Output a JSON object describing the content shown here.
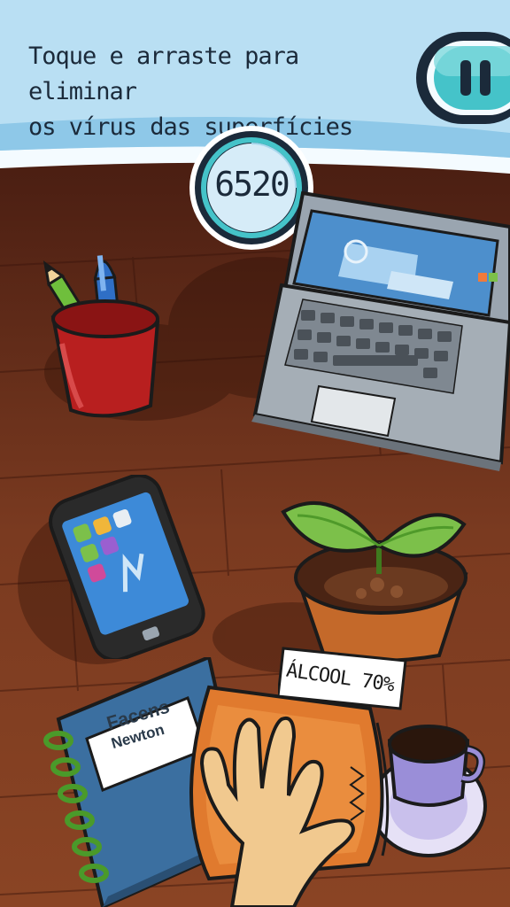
{
  "hud": {
    "instruction_line1": "Toque e arraste para eliminar",
    "instruction_line2": "os vírus das superfícies",
    "score": "6520",
    "pause_icon": "pause-icon"
  },
  "items": {
    "sanitizer_label": "ÁLCOOL 70%",
    "notebook_brand1": "Facens",
    "notebook_brand2": "Newton"
  },
  "colors": {
    "banner": "#b9dff3",
    "desk": "#6a2f1c",
    "ui_dark": "#1b2a3a",
    "accent_teal": "#45c3c9"
  }
}
